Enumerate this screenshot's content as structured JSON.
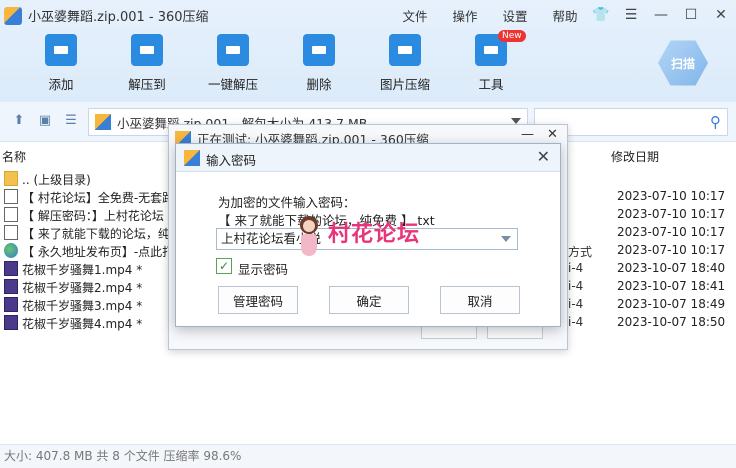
{
  "window": {
    "title": "小巫婆舞蹈.zip.001 - 360压缩",
    "menus": [
      "文件",
      "操作",
      "设置",
      "帮助"
    ]
  },
  "toolbar": {
    "tools": [
      {
        "label": "添加",
        "icon": "add-icon"
      },
      {
        "label": "解压到",
        "icon": "extract-icon"
      },
      {
        "label": "一键解压",
        "icon": "one-click-extract-icon"
      },
      {
        "label": "删除",
        "icon": "delete-icon"
      },
      {
        "label": "图片压缩",
        "icon": "image-compress-icon"
      },
      {
        "label": "工具",
        "icon": "tools-icon",
        "badge": "New"
      }
    ],
    "scan_label": "扫描"
  },
  "address": {
    "path": "小巫婆舞蹈.zip.001 - 解包大小为 413.7 MB"
  },
  "columns": {
    "name": "名称",
    "modified": "修改日期"
  },
  "files": [
    {
      "icon": "folder",
      "name": ".. (上级目录)",
      "type": "",
      "date": ""
    },
    {
      "icon": "doc",
      "name": "【 村花论坛】全免费-无套路",
      "type": "",
      "date": "2023-07-10 10:17"
    },
    {
      "icon": "doc",
      "name": "【 解压密码：】上村花论坛",
      "type": "",
      "date": "2023-07-10 10:17"
    },
    {
      "icon": "doc",
      "name": "【 来了就能下载的论坛，纯",
      "type": "",
      "date": "2023-07-10 10:17"
    },
    {
      "icon": "globe",
      "name": "【 永久地址发布页】-点此打",
      "type": "方式",
      "date": "2023-07-10 10:17"
    },
    {
      "icon": "mp4",
      "name": "花椒千岁骚舞1.mp4 *",
      "type": "i-4",
      "date": "2023-10-07 18:40"
    },
    {
      "icon": "mp4",
      "name": "花椒千岁骚舞2.mp4 *",
      "type": "i-4",
      "date": "2023-10-07 18:41"
    },
    {
      "icon": "mp4",
      "name": "花椒千岁骚舞3.mp4 *",
      "type": "i-4",
      "date": "2023-10-07 18:49"
    },
    {
      "icon": "mp4",
      "name": "花椒千岁骚舞4.mp4 *",
      "type": "i-4",
      "date": "2023-10-07 18:50"
    }
  ],
  "status": "大小: 407.8 MB 共 8 个文件 压缩率 98.6%",
  "back_dialog": {
    "title": "正在测试: 小巫婆舞蹈.zip.001 - 360压缩"
  },
  "password_dialog": {
    "title": "输入密码",
    "prompt": "为加密的文件输入密码：",
    "file_name": "【 来了就能下载的论坛，纯免费 】.txt",
    "password_value": "上村花论坛看小说",
    "show_password_label": "显示密码",
    "show_password_checked": true,
    "manage_label": "管理密码",
    "ok_label": "确定",
    "cancel_label": "取消"
  },
  "watermark": {
    "text": "村花论坛"
  }
}
